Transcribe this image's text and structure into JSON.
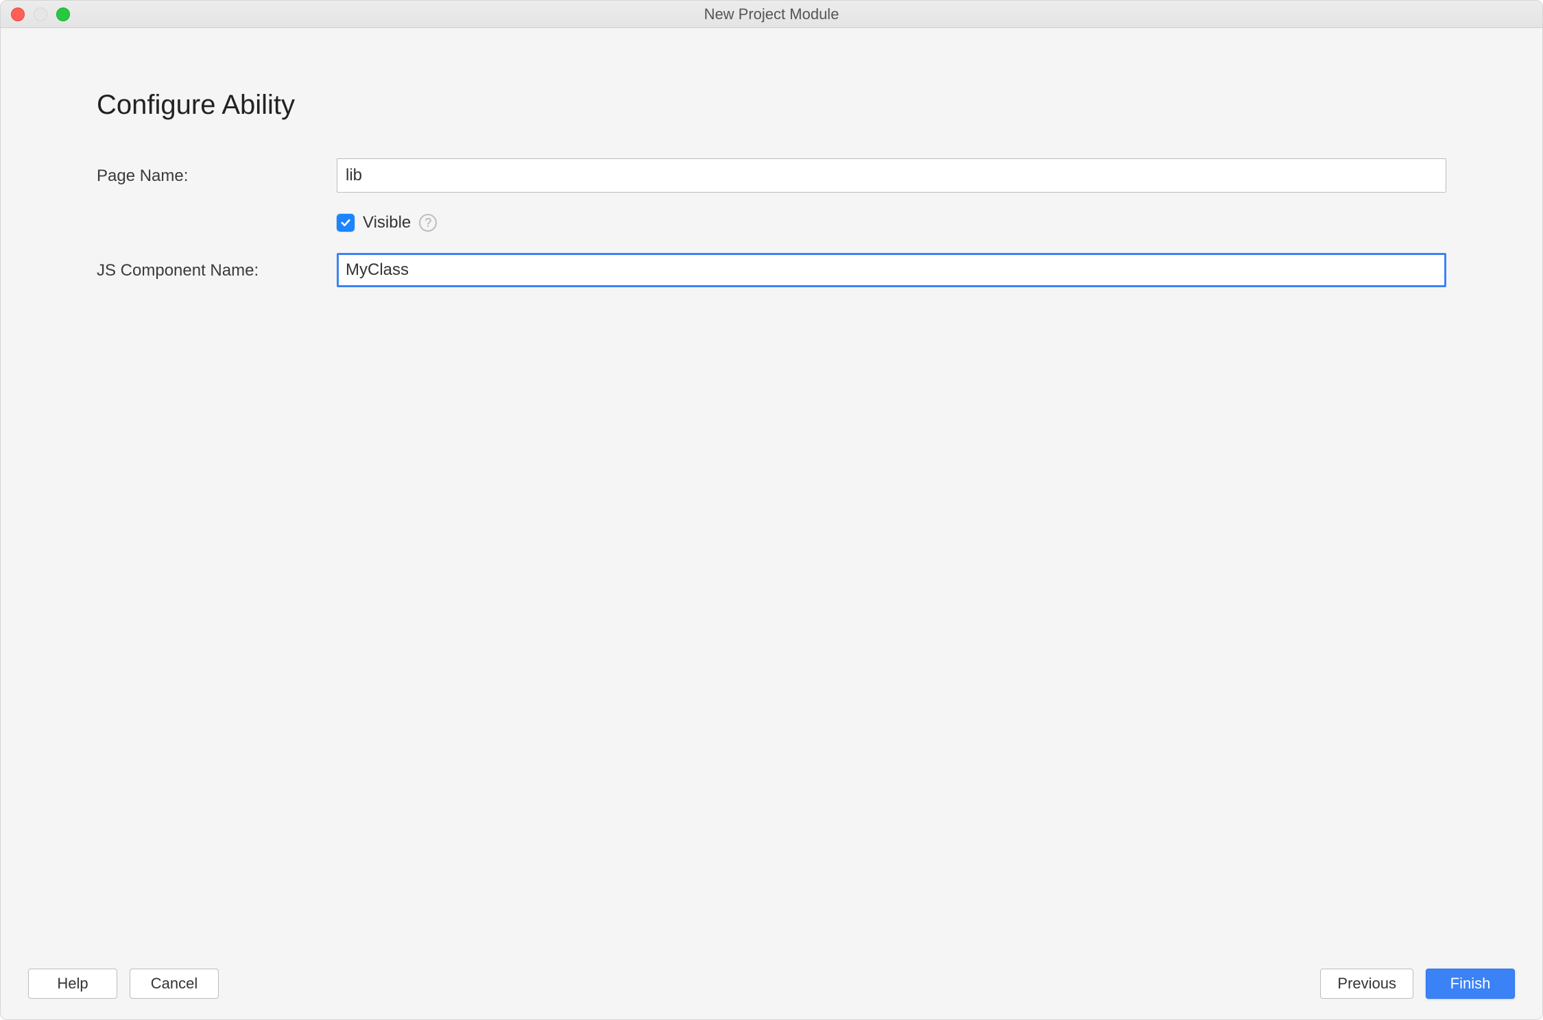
{
  "window": {
    "title": "New Project Module"
  },
  "page": {
    "heading": "Configure Ability"
  },
  "form": {
    "page_name": {
      "label": "Page Name:",
      "value": "lib"
    },
    "visible": {
      "label": "Visible",
      "checked": true
    },
    "js_component_name": {
      "label": "JS Component Name:",
      "value": "MyClass"
    }
  },
  "footer": {
    "help": "Help",
    "cancel": "Cancel",
    "previous": "Previous",
    "finish": "Finish"
  }
}
